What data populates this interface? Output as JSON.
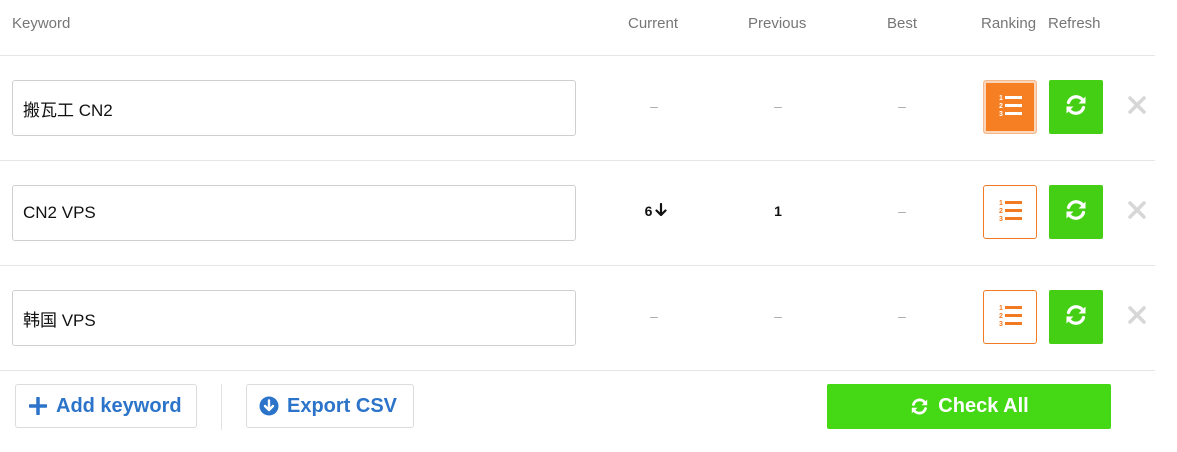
{
  "header": {
    "keyword": "Keyword",
    "current": "Current",
    "previous": "Previous",
    "best": "Best",
    "ranking": "Ranking",
    "refresh": "Refresh"
  },
  "rows": [
    {
      "keyword": "搬瓦工 CN2",
      "current": "–",
      "previous": "–",
      "best": "–",
      "ranking_active": true
    },
    {
      "keyword": "CN2 VPS",
      "current": "6",
      "current_trend": "down",
      "previous": "1",
      "best": "–",
      "ranking_active": false
    },
    {
      "keyword": "韩国 VPS",
      "current": "–",
      "previous": "–",
      "best": "–",
      "ranking_active": false
    }
  ],
  "footer": {
    "add_keyword": "Add keyword",
    "export_csv": "Export CSV",
    "check_all": "Check All"
  },
  "icons": {
    "ranking": "numbered-list-icon",
    "refresh": "refresh-icon",
    "delete": "close-icon",
    "add": "plus-icon",
    "export": "download-circle-icon",
    "trend_down": "arrow-down-icon"
  },
  "colors": {
    "orange": "#f77f23",
    "green": "#44cf14",
    "blue": "#2b74c9",
    "gray": "#aaaaaa"
  }
}
